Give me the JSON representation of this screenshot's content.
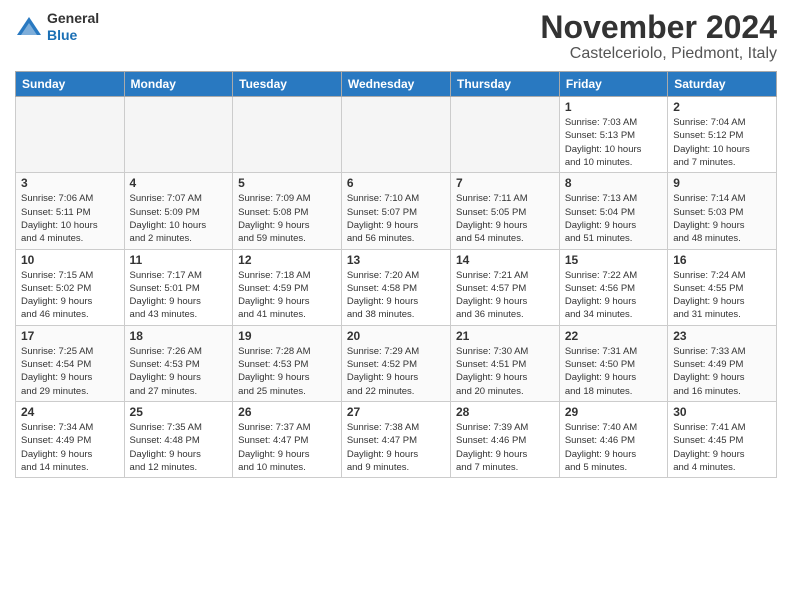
{
  "header": {
    "logo_line1": "General",
    "logo_line2": "Blue",
    "month": "November 2024",
    "location": "Castelceriolo, Piedmont, Italy"
  },
  "weekdays": [
    "Sunday",
    "Monday",
    "Tuesday",
    "Wednesday",
    "Thursday",
    "Friday",
    "Saturday"
  ],
  "weeks": [
    [
      {
        "day": "",
        "info": ""
      },
      {
        "day": "",
        "info": ""
      },
      {
        "day": "",
        "info": ""
      },
      {
        "day": "",
        "info": ""
      },
      {
        "day": "",
        "info": ""
      },
      {
        "day": "1",
        "info": "Sunrise: 7:03 AM\nSunset: 5:13 PM\nDaylight: 10 hours\nand 10 minutes."
      },
      {
        "day": "2",
        "info": "Sunrise: 7:04 AM\nSunset: 5:12 PM\nDaylight: 10 hours\nand 7 minutes."
      }
    ],
    [
      {
        "day": "3",
        "info": "Sunrise: 7:06 AM\nSunset: 5:11 PM\nDaylight: 10 hours\nand 4 minutes."
      },
      {
        "day": "4",
        "info": "Sunrise: 7:07 AM\nSunset: 5:09 PM\nDaylight: 10 hours\nand 2 minutes."
      },
      {
        "day": "5",
        "info": "Sunrise: 7:09 AM\nSunset: 5:08 PM\nDaylight: 9 hours\nand 59 minutes."
      },
      {
        "day": "6",
        "info": "Sunrise: 7:10 AM\nSunset: 5:07 PM\nDaylight: 9 hours\nand 56 minutes."
      },
      {
        "day": "7",
        "info": "Sunrise: 7:11 AM\nSunset: 5:05 PM\nDaylight: 9 hours\nand 54 minutes."
      },
      {
        "day": "8",
        "info": "Sunrise: 7:13 AM\nSunset: 5:04 PM\nDaylight: 9 hours\nand 51 minutes."
      },
      {
        "day": "9",
        "info": "Sunrise: 7:14 AM\nSunset: 5:03 PM\nDaylight: 9 hours\nand 48 minutes."
      }
    ],
    [
      {
        "day": "10",
        "info": "Sunrise: 7:15 AM\nSunset: 5:02 PM\nDaylight: 9 hours\nand 46 minutes."
      },
      {
        "day": "11",
        "info": "Sunrise: 7:17 AM\nSunset: 5:01 PM\nDaylight: 9 hours\nand 43 minutes."
      },
      {
        "day": "12",
        "info": "Sunrise: 7:18 AM\nSunset: 4:59 PM\nDaylight: 9 hours\nand 41 minutes."
      },
      {
        "day": "13",
        "info": "Sunrise: 7:20 AM\nSunset: 4:58 PM\nDaylight: 9 hours\nand 38 minutes."
      },
      {
        "day": "14",
        "info": "Sunrise: 7:21 AM\nSunset: 4:57 PM\nDaylight: 9 hours\nand 36 minutes."
      },
      {
        "day": "15",
        "info": "Sunrise: 7:22 AM\nSunset: 4:56 PM\nDaylight: 9 hours\nand 34 minutes."
      },
      {
        "day": "16",
        "info": "Sunrise: 7:24 AM\nSunset: 4:55 PM\nDaylight: 9 hours\nand 31 minutes."
      }
    ],
    [
      {
        "day": "17",
        "info": "Sunrise: 7:25 AM\nSunset: 4:54 PM\nDaylight: 9 hours\nand 29 minutes."
      },
      {
        "day": "18",
        "info": "Sunrise: 7:26 AM\nSunset: 4:53 PM\nDaylight: 9 hours\nand 27 minutes."
      },
      {
        "day": "19",
        "info": "Sunrise: 7:28 AM\nSunset: 4:53 PM\nDaylight: 9 hours\nand 25 minutes."
      },
      {
        "day": "20",
        "info": "Sunrise: 7:29 AM\nSunset: 4:52 PM\nDaylight: 9 hours\nand 22 minutes."
      },
      {
        "day": "21",
        "info": "Sunrise: 7:30 AM\nSunset: 4:51 PM\nDaylight: 9 hours\nand 20 minutes."
      },
      {
        "day": "22",
        "info": "Sunrise: 7:31 AM\nSunset: 4:50 PM\nDaylight: 9 hours\nand 18 minutes."
      },
      {
        "day": "23",
        "info": "Sunrise: 7:33 AM\nSunset: 4:49 PM\nDaylight: 9 hours\nand 16 minutes."
      }
    ],
    [
      {
        "day": "24",
        "info": "Sunrise: 7:34 AM\nSunset: 4:49 PM\nDaylight: 9 hours\nand 14 minutes."
      },
      {
        "day": "25",
        "info": "Sunrise: 7:35 AM\nSunset: 4:48 PM\nDaylight: 9 hours\nand 12 minutes."
      },
      {
        "day": "26",
        "info": "Sunrise: 7:37 AM\nSunset: 4:47 PM\nDaylight: 9 hours\nand 10 minutes."
      },
      {
        "day": "27",
        "info": "Sunrise: 7:38 AM\nSunset: 4:47 PM\nDaylight: 9 hours\nand 9 minutes."
      },
      {
        "day": "28",
        "info": "Sunrise: 7:39 AM\nSunset: 4:46 PM\nDaylight: 9 hours\nand 7 minutes."
      },
      {
        "day": "29",
        "info": "Sunrise: 7:40 AM\nSunset: 4:46 PM\nDaylight: 9 hours\nand 5 minutes."
      },
      {
        "day": "30",
        "info": "Sunrise: 7:41 AM\nSunset: 4:45 PM\nDaylight: 9 hours\nand 4 minutes."
      }
    ]
  ]
}
